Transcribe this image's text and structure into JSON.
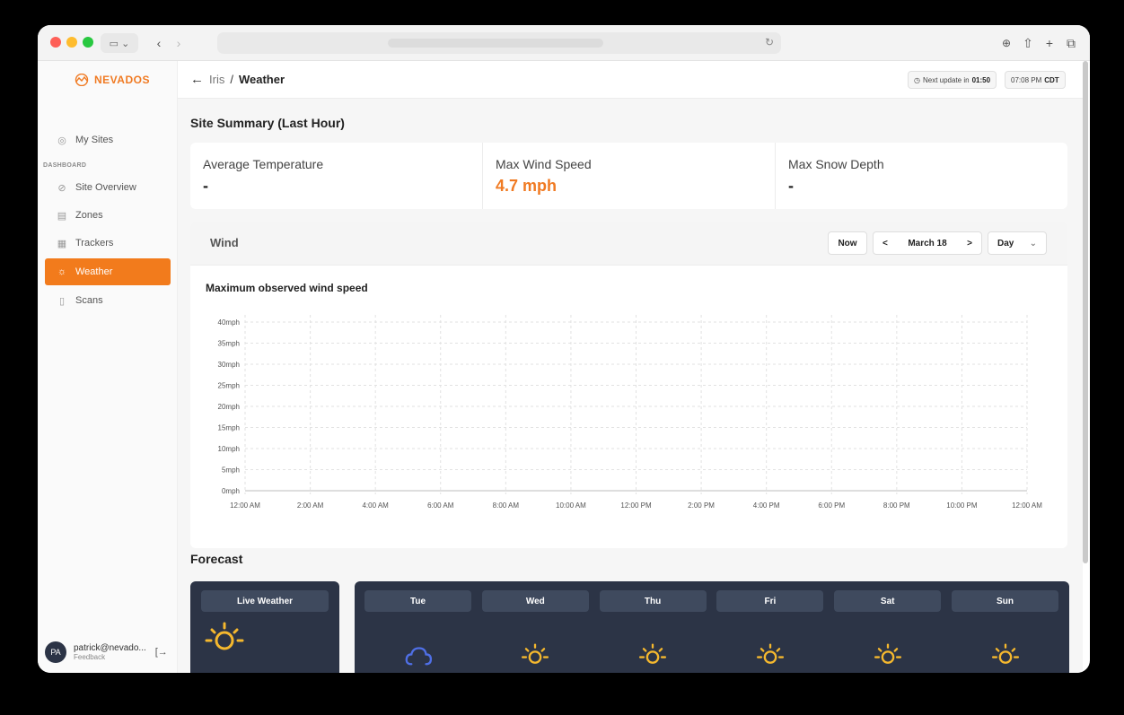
{
  "app": {
    "brand": "NEVADOS",
    "accent": "#f27b1c",
    "sidebar_bg": "#fafafa",
    "dark_panel": "#2c3446"
  },
  "sidebar": {
    "my_sites": "My Sites",
    "section_label": "DASHBOARD",
    "items": [
      {
        "label": "Site Overview",
        "icon": "compass-icon"
      },
      {
        "label": "Zones",
        "icon": "zones-icon"
      },
      {
        "label": "Trackers",
        "icon": "solar-panel-icon"
      },
      {
        "label": "Weather",
        "icon": "weather-icon",
        "active": true
      },
      {
        "label": "Scans",
        "icon": "scan-icon"
      }
    ],
    "user": {
      "initials": "PA",
      "email": "patrick@nevado...",
      "sub": "Feedback"
    }
  },
  "topbar": {
    "crumb_parent": "Iris",
    "crumb_sep": "/",
    "crumb_current": "Weather",
    "next_update_label": "Next update in",
    "next_update_value": "01:50",
    "time": "07:08 PM",
    "timezone": "CDT"
  },
  "summary": {
    "heading": "Site Summary (Last Hour)",
    "cards": [
      {
        "label": "Average Temperature",
        "value": "-"
      },
      {
        "label": "Max Wind Speed",
        "value": "4.7 mph"
      },
      {
        "label": "Max Snow Depth",
        "value": "-"
      }
    ]
  },
  "wind": {
    "title": "Wind",
    "now": "Now",
    "prev": "<",
    "date": "March 18",
    "next": ">",
    "range": "Day",
    "chart_title": "Maximum observed wind speed"
  },
  "chart_data": {
    "type": "line",
    "title": "Maximum observed wind speed",
    "xlabel": "",
    "ylabel": "",
    "x": [
      "12:00 AM",
      "2:00 AM",
      "4:00 AM",
      "6:00 AM",
      "8:00 AM",
      "10:00 AM",
      "12:00 PM",
      "2:00 PM",
      "4:00 PM",
      "6:00 PM",
      "8:00 PM",
      "10:00 PM",
      "12:00 AM"
    ],
    "y_ticks": [
      "0mph",
      "5mph",
      "10mph",
      "15mph",
      "20mph",
      "25mph",
      "30mph",
      "35mph",
      "40mph"
    ],
    "ylim": [
      0,
      40
    ],
    "grid": true,
    "series": []
  },
  "forecast": {
    "heading": "Forecast",
    "live_label": "Live Weather",
    "days": [
      {
        "label": "Tue",
        "icon": "cloud-icon"
      },
      {
        "label": "Wed",
        "icon": "sun-icon"
      },
      {
        "label": "Thu",
        "icon": "sun-icon"
      },
      {
        "label": "Fri",
        "icon": "sun-icon"
      },
      {
        "label": "Sat",
        "icon": "sun-icon"
      },
      {
        "label": "Sun",
        "icon": "sun-icon"
      }
    ]
  }
}
